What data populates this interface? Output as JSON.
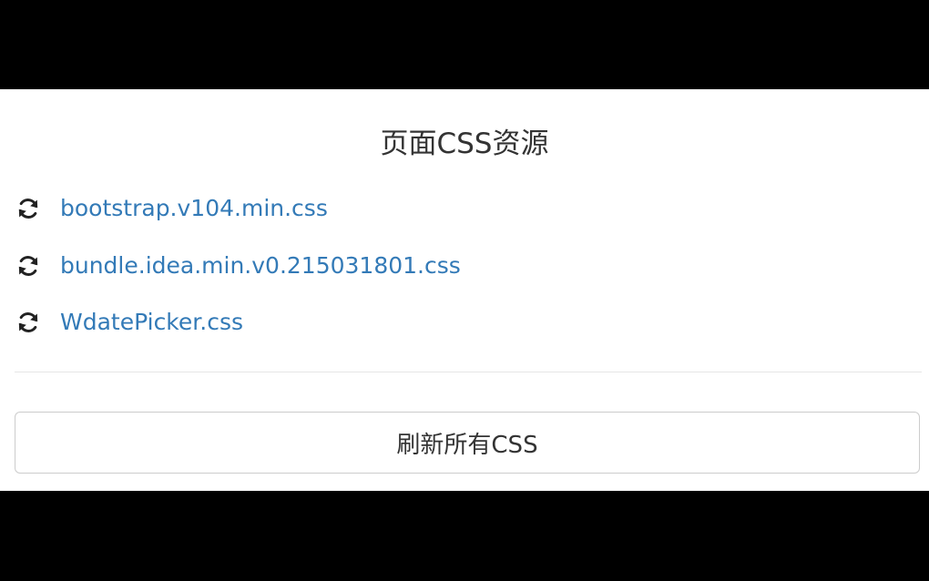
{
  "panel": {
    "title": "页面CSS资源"
  },
  "resources": [
    {
      "name": "bootstrap.v104.min.css",
      "icon": "refresh-icon"
    },
    {
      "name": "bundle.idea.min.v0.215031801.css",
      "icon": "refresh-icon"
    },
    {
      "name": "WdatePicker.css",
      "icon": "refresh-icon"
    }
  ],
  "actions": {
    "refresh_all_label": "刷新所有CSS"
  },
  "colors": {
    "link": "#337ab7",
    "text": "#333333",
    "border": "#cccccc",
    "letterbox": "#000000"
  }
}
